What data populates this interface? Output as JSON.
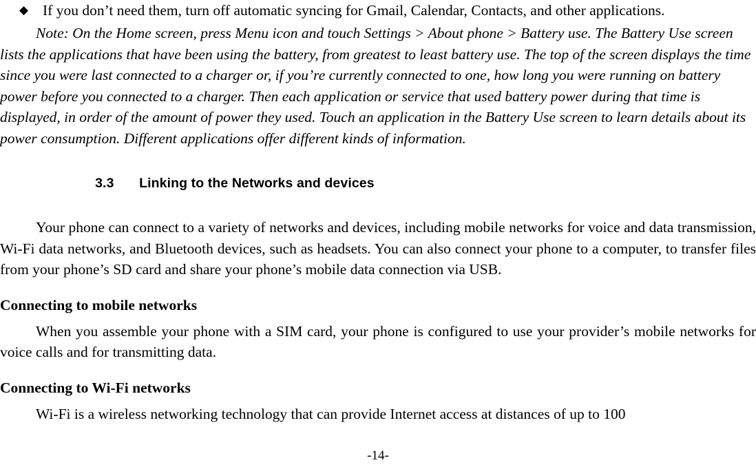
{
  "document": {
    "page_number_label": "-14-",
    "bullets": [
      {
        "marker": "◆",
        "text": "If you don’t need them, turn off automatic syncing for Gmail, Calendar, Contacts, and other applications."
      }
    ],
    "note": {
      "line1": "Note: On the Home screen, press Menu icon and touch Settings > About phone > Battery use. The",
      "line2": "Battery Use screen lists the applications that have been using the battery, from greatest to least battery use.",
      "line3": "The top of the screen displays the time since you were last connected to a charger or, if you’re currently",
      "line4": "connected to one, how long you were running on battery power before you connected to a charger. Then each",
      "line5": "application or service that used battery power during that time is displayed, in order of the amount of power",
      "line6": "they used. Touch an application in the Battery Use screen to learn details about its power consumption.",
      "line7": "Different applications offer different kinds of information."
    },
    "section": {
      "number": "3.3",
      "title": "Linking to the Networks and devices"
    },
    "paragraphs": {
      "intro": "Your phone can connect to a variety of networks and devices, including mobile networks for voice and data transmission, Wi-Fi data networks, and Bluetooth devices, such as headsets. You can also connect your phone to a computer, to transfer files from your phone’s SD card and share your phone’s mobile data connection via USB.",
      "mobile_body": "When you assemble your phone with a SIM card, your phone is configured to use your provider’s mobile networks for voice calls and for transmitting data.",
      "wifi_body": "Wi-Fi is a wireless networking technology that can provide Internet access at distances of up to 100"
    },
    "subheadings": {
      "mobile": "Connecting to mobile networks",
      "wifi": "Connecting to Wi-Fi networks"
    }
  }
}
